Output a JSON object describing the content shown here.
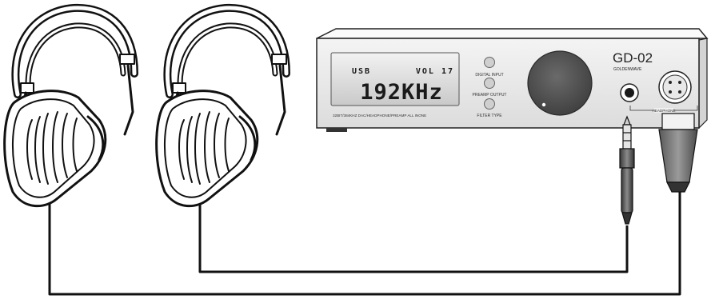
{
  "device": {
    "model": "GD-02",
    "brand": "GOLDENWAVE",
    "description": "32BIT/384KHZ DAC/HEADPHONE/PREAMP ALL INONE",
    "display": {
      "source": "USB",
      "volume": "VOL 17",
      "sample_rate": "192KHz"
    },
    "buttons": [
      {
        "label": "DIGITAL INPUT"
      },
      {
        "label": "PREAMP OUTPUT"
      },
      {
        "label": "FILTER TYPE"
      }
    ],
    "headphone_label": "HEADPHONE"
  }
}
